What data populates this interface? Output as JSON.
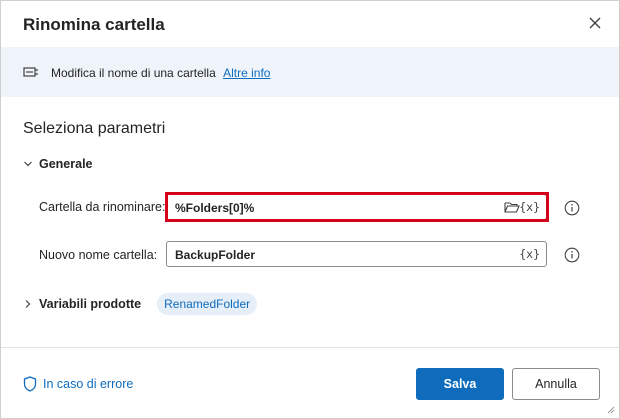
{
  "dialog": {
    "title": "Rinomina cartella",
    "close_icon": "close-icon"
  },
  "banner": {
    "icon": "action-icon",
    "description": "Modifica il nome di una cartella",
    "more_info_link": "Altre info"
  },
  "parameters": {
    "section_title": "Seleziona parametri",
    "general_group": "Generale",
    "fields": [
      {
        "label": "Cartella da rinominare:",
        "value": "%Folders[0]%",
        "var_button": "{x}",
        "has_folder_picker": true,
        "highlighted": true
      },
      {
        "label": "Nuovo nome cartella:",
        "value": "BackupFolder",
        "var_button": "{x}",
        "has_folder_picker": false,
        "highlighted": false
      }
    ],
    "variables_group": "Variabili prodotte",
    "variable_pill": "RenamedFolder"
  },
  "footer": {
    "on_error_label": "In caso di errore",
    "save_label": "Salva",
    "cancel_label": "Annulla"
  },
  "colors": {
    "accent": "#0f6cbd",
    "highlight_border": "#d6001c",
    "banner_bg": "#eff4fa"
  }
}
